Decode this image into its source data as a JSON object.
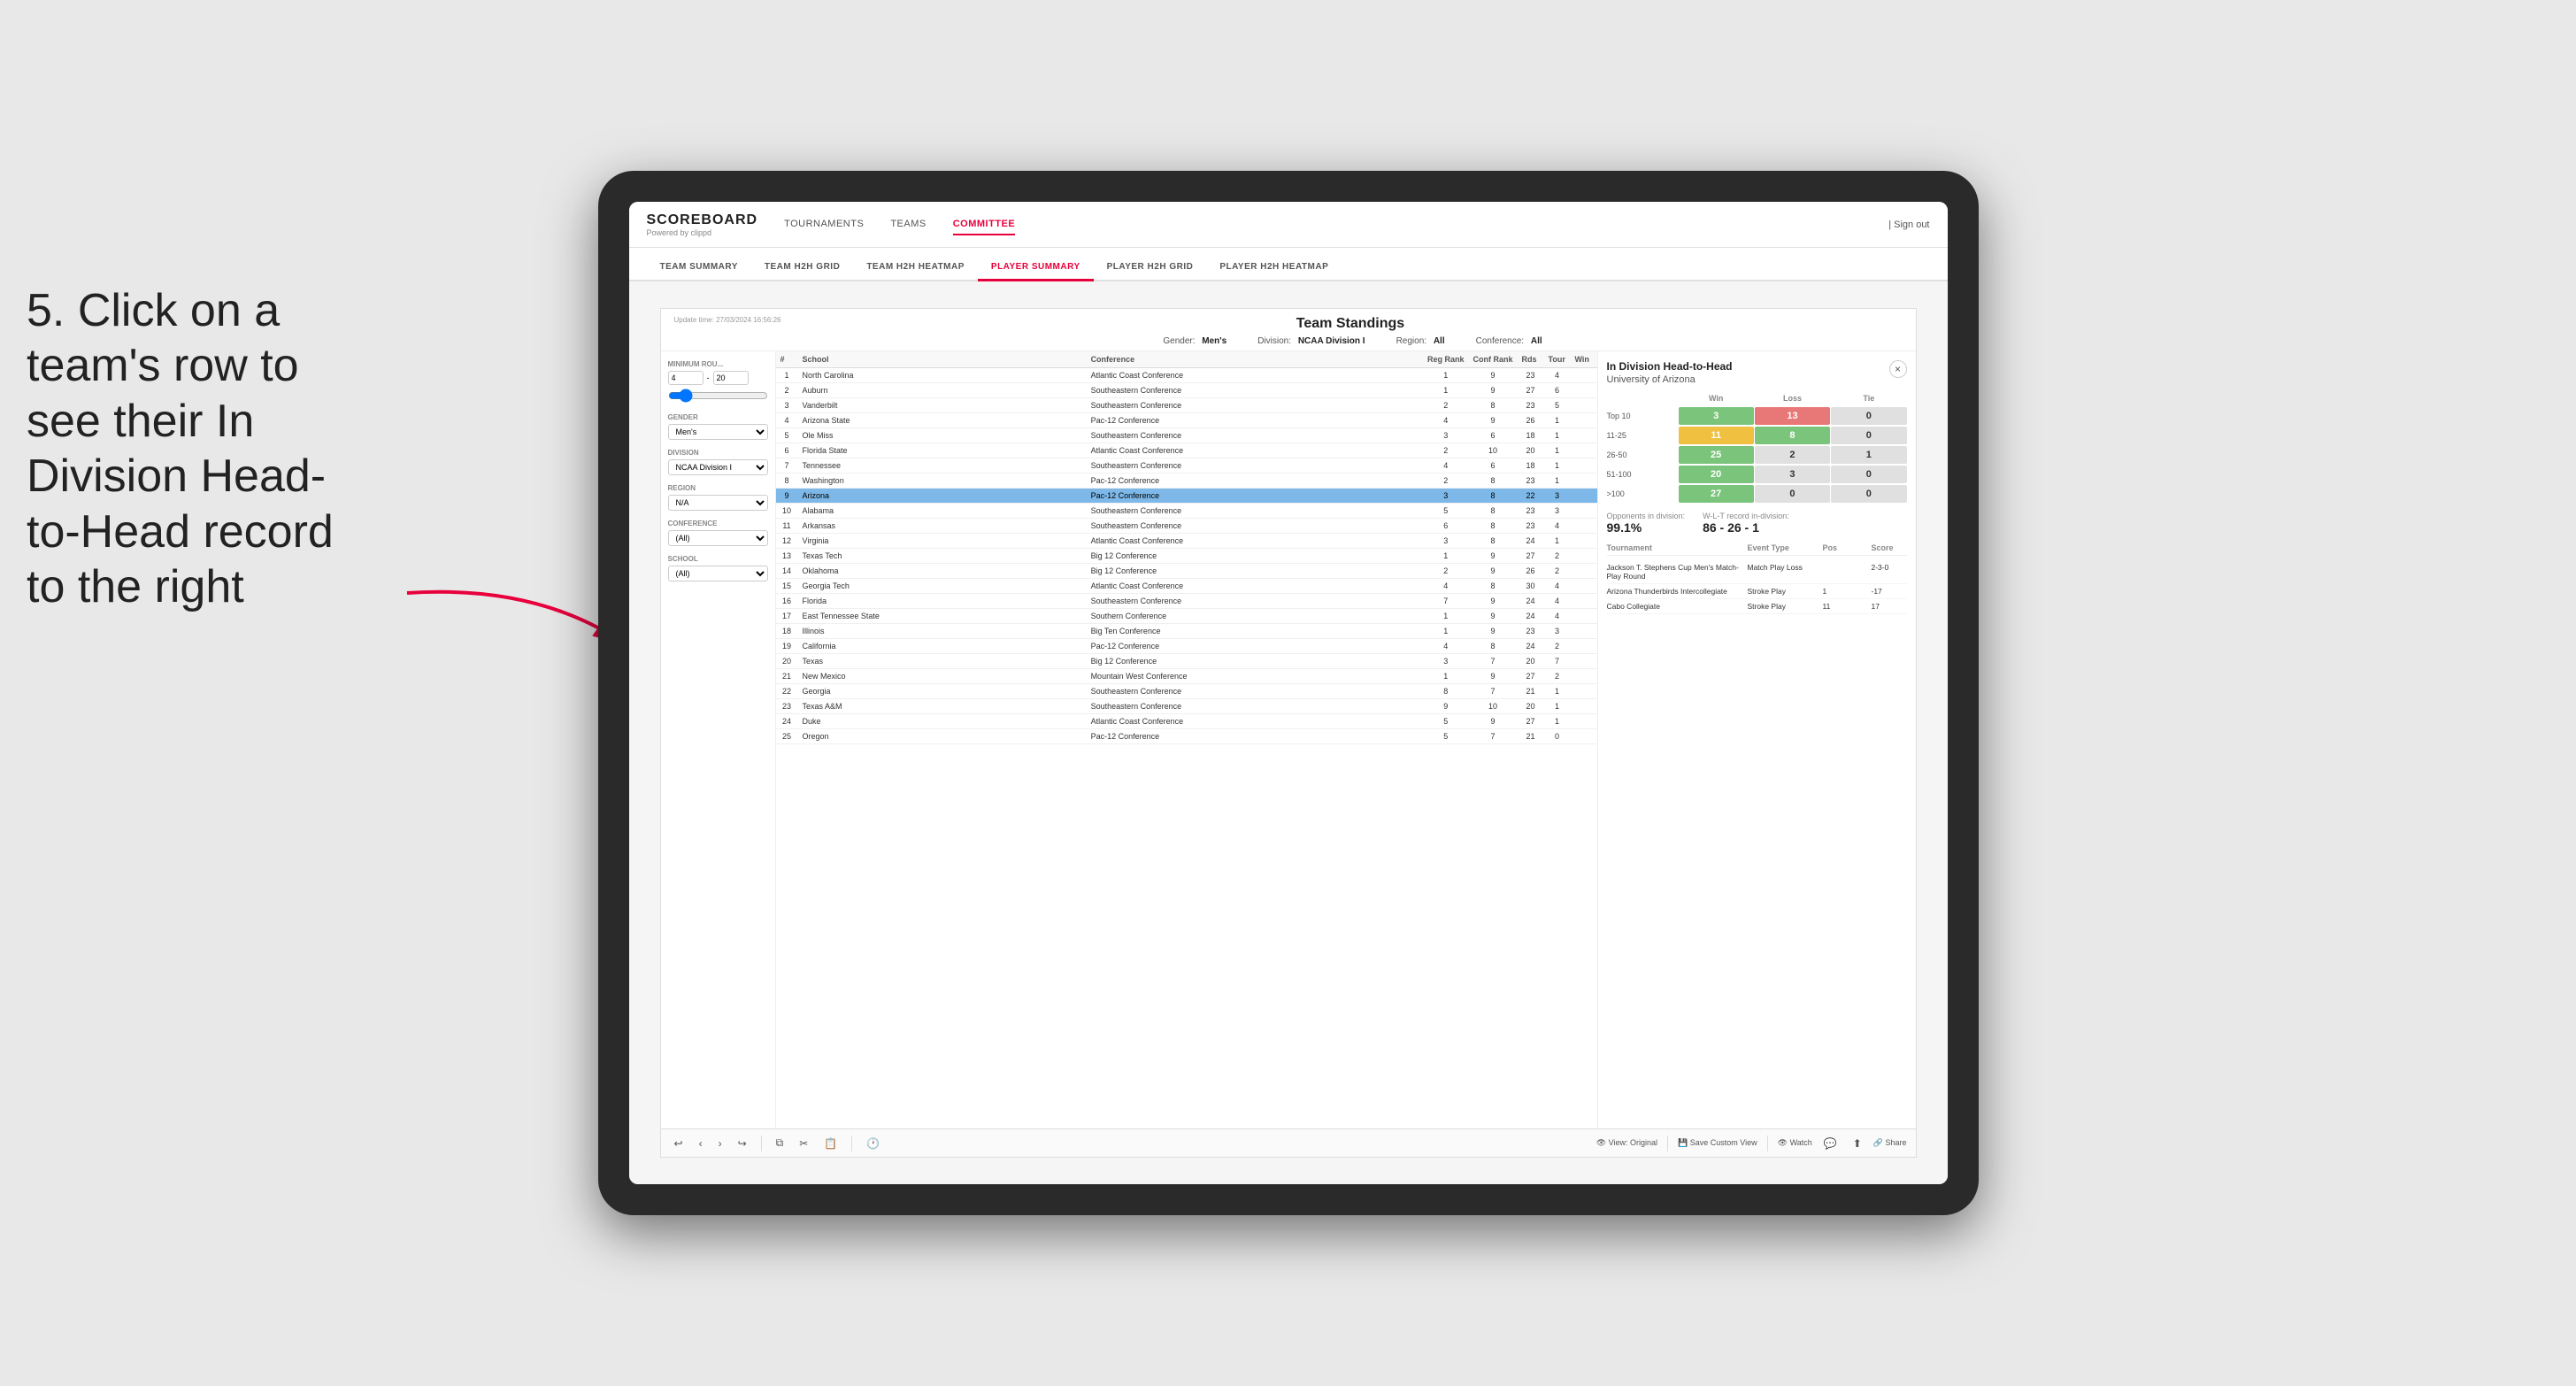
{
  "page": {
    "background": "#e8e8e8"
  },
  "instruction": {
    "text": "5. Click on a team's row to see their In Division Head-to-Head record to the right"
  },
  "nav": {
    "logo": "SCOREBOARD",
    "logo_sub": "Powered by clippd",
    "links": [
      "TOURNAMENTS",
      "TEAMS",
      "COMMITTEE"
    ],
    "active_link": "COMMITTEE",
    "sign_out": "Sign out"
  },
  "sub_nav": {
    "items": [
      "TEAM SUMMARY",
      "TEAM H2H GRID",
      "TEAM H2H HEATMAP",
      "PLAYER SUMMARY",
      "PLAYER H2H GRID",
      "PLAYER H2H HEATMAP"
    ],
    "active_item": "PLAYER SUMMARY"
  },
  "panel": {
    "update_time_label": "Update time:",
    "update_time": "27/03/2024 16:56:26",
    "title": "Team Standings",
    "gender_label": "Gender:",
    "gender": "Men's",
    "division_label": "Division:",
    "division": "NCAA Division I",
    "region_label": "Region:",
    "region": "All",
    "conference_label": "Conference:",
    "conference": "All"
  },
  "filters": {
    "min_rounds_label": "Minimum Rou...",
    "min_rounds_val": "4",
    "min_rounds_max": "20",
    "gender_label": "Gender",
    "gender_val": "Men's",
    "division_label": "Division",
    "division_val": "NCAA Division I",
    "region_label": "Region",
    "region_val": "N/A",
    "conference_label": "Conference",
    "conference_val": "(All)",
    "school_label": "School",
    "school_val": "(All)"
  },
  "table": {
    "headers": [
      "#",
      "School",
      "Conference",
      "Reg Rank",
      "Conf Rank",
      "Rds",
      "Tour",
      "Win"
    ],
    "rows": [
      {
        "rank": "1",
        "school": "North Carolina",
        "conference": "Atlantic Coast Conference",
        "reg_rank": "1",
        "conf_rank": "9",
        "rds": "23",
        "tour": "4",
        "win": "",
        "highlighted": false
      },
      {
        "rank": "2",
        "school": "Auburn",
        "conference": "Southeastern Conference",
        "reg_rank": "1",
        "conf_rank": "9",
        "rds": "27",
        "tour": "6",
        "win": "",
        "highlighted": false
      },
      {
        "rank": "3",
        "school": "Vanderbilt",
        "conference": "Southeastern Conference",
        "reg_rank": "2",
        "conf_rank": "8",
        "rds": "23",
        "tour": "5",
        "win": "",
        "highlighted": false
      },
      {
        "rank": "4",
        "school": "Arizona State",
        "conference": "Pac-12 Conference",
        "reg_rank": "4",
        "conf_rank": "9",
        "rds": "26",
        "tour": "1",
        "win": "",
        "highlighted": false
      },
      {
        "rank": "5",
        "school": "Ole Miss",
        "conference": "Southeastern Conference",
        "reg_rank": "3",
        "conf_rank": "6",
        "rds": "18",
        "tour": "1",
        "win": "",
        "highlighted": false
      },
      {
        "rank": "6",
        "school": "Florida State",
        "conference": "Atlantic Coast Conference",
        "reg_rank": "2",
        "conf_rank": "10",
        "rds": "20",
        "tour": "1",
        "win": "",
        "highlighted": false
      },
      {
        "rank": "7",
        "school": "Tennessee",
        "conference": "Southeastern Conference",
        "reg_rank": "4",
        "conf_rank": "6",
        "rds": "18",
        "tour": "1",
        "win": "",
        "highlighted": false
      },
      {
        "rank": "8",
        "school": "Washington",
        "conference": "Pac-12 Conference",
        "reg_rank": "2",
        "conf_rank": "8",
        "rds": "23",
        "tour": "1",
        "win": "",
        "highlighted": false
      },
      {
        "rank": "9",
        "school": "Arizona",
        "conference": "Pac-12 Conference",
        "reg_rank": "3",
        "conf_rank": "8",
        "rds": "22",
        "tour": "3",
        "win": "",
        "highlighted": true
      },
      {
        "rank": "10",
        "school": "Alabama",
        "conference": "Southeastern Conference",
        "reg_rank": "5",
        "conf_rank": "8",
        "rds": "23",
        "tour": "3",
        "win": "",
        "highlighted": false
      },
      {
        "rank": "11",
        "school": "Arkansas",
        "conference": "Southeastern Conference",
        "reg_rank": "6",
        "conf_rank": "8",
        "rds": "23",
        "tour": "4",
        "win": "",
        "highlighted": false
      },
      {
        "rank": "12",
        "school": "Virginia",
        "conference": "Atlantic Coast Conference",
        "reg_rank": "3",
        "conf_rank": "8",
        "rds": "24",
        "tour": "1",
        "win": "",
        "highlighted": false
      },
      {
        "rank": "13",
        "school": "Texas Tech",
        "conference": "Big 12 Conference",
        "reg_rank": "1",
        "conf_rank": "9",
        "rds": "27",
        "tour": "2",
        "win": "",
        "highlighted": false
      },
      {
        "rank": "14",
        "school": "Oklahoma",
        "conference": "Big 12 Conference",
        "reg_rank": "2",
        "conf_rank": "9",
        "rds": "26",
        "tour": "2",
        "win": "",
        "highlighted": false
      },
      {
        "rank": "15",
        "school": "Georgia Tech",
        "conference": "Atlantic Coast Conference",
        "reg_rank": "4",
        "conf_rank": "8",
        "rds": "30",
        "tour": "4",
        "win": "",
        "highlighted": false
      },
      {
        "rank": "16",
        "school": "Florida",
        "conference": "Southeastern Conference",
        "reg_rank": "7",
        "conf_rank": "9",
        "rds": "24",
        "tour": "4",
        "win": "",
        "highlighted": false
      },
      {
        "rank": "17",
        "school": "East Tennessee State",
        "conference": "Southern Conference",
        "reg_rank": "1",
        "conf_rank": "9",
        "rds": "24",
        "tour": "4",
        "win": "",
        "highlighted": false
      },
      {
        "rank": "18",
        "school": "Illinois",
        "conference": "Big Ten Conference",
        "reg_rank": "1",
        "conf_rank": "9",
        "rds": "23",
        "tour": "3",
        "win": "",
        "highlighted": false
      },
      {
        "rank": "19",
        "school": "California",
        "conference": "Pac-12 Conference",
        "reg_rank": "4",
        "conf_rank": "8",
        "rds": "24",
        "tour": "2",
        "win": "",
        "highlighted": false
      },
      {
        "rank": "20",
        "school": "Texas",
        "conference": "Big 12 Conference",
        "reg_rank": "3",
        "conf_rank": "7",
        "rds": "20",
        "tour": "7",
        "win": "",
        "highlighted": false
      },
      {
        "rank": "21",
        "school": "New Mexico",
        "conference": "Mountain West Conference",
        "reg_rank": "1",
        "conf_rank": "9",
        "rds": "27",
        "tour": "2",
        "win": "",
        "highlighted": false
      },
      {
        "rank": "22",
        "school": "Georgia",
        "conference": "Southeastern Conference",
        "reg_rank": "8",
        "conf_rank": "7",
        "rds": "21",
        "tour": "1",
        "win": "",
        "highlighted": false
      },
      {
        "rank": "23",
        "school": "Texas A&M",
        "conference": "Southeastern Conference",
        "reg_rank": "9",
        "conf_rank": "10",
        "rds": "20",
        "tour": "1",
        "win": "",
        "highlighted": false
      },
      {
        "rank": "24",
        "school": "Duke",
        "conference": "Atlantic Coast Conference",
        "reg_rank": "5",
        "conf_rank": "9",
        "rds": "27",
        "tour": "1",
        "win": "",
        "highlighted": false
      },
      {
        "rank": "25",
        "school": "Oregon",
        "conference": "Pac-12 Conference",
        "reg_rank": "5",
        "conf_rank": "7",
        "rds": "21",
        "tour": "0",
        "win": "",
        "highlighted": false
      }
    ]
  },
  "h2h": {
    "title": "In Division Head-to-Head",
    "school": "University of Arizona",
    "close_label": "×",
    "col_headers": [
      "",
      "Win",
      "Loss",
      "Tie"
    ],
    "rows": [
      {
        "range": "Top 10",
        "win": "3",
        "loss": "13",
        "tie": "0",
        "win_color": "green",
        "loss_color": "red",
        "tie_color": "gray"
      },
      {
        "range": "11-25",
        "win": "11",
        "loss": "8",
        "tie": "0",
        "win_color": "yellow",
        "loss_color": "green",
        "tie_color": "gray"
      },
      {
        "range": "26-50",
        "win": "25",
        "loss": "2",
        "tie": "1",
        "win_color": "green",
        "loss_color": "gray",
        "tie_color": "gray"
      },
      {
        "range": "51-100",
        "win": "20",
        "loss": "3",
        "tie": "0",
        "win_color": "green",
        "loss_color": "gray",
        "tie_color": "gray"
      },
      {
        "range": ">100",
        "win": "27",
        "loss": "0",
        "tie": "0",
        "win_color": "green",
        "loss_color": "gray",
        "tie_color": "gray"
      }
    ],
    "opponents_label": "Opponents in division:",
    "opponents_pct": "99.1%",
    "wlt_label": "W-L-T record in-division:",
    "wlt_record": "86 - 26 - 1",
    "tournaments_label": "Tournament",
    "event_type_label": "Event Type",
    "pos_label": "Pos",
    "score_label": "Score",
    "tournaments": [
      {
        "name": "Jackson T. Stephens Cup Men's Match-Play Round",
        "event_type": "Match Play",
        "result": "Loss",
        "score": "2-3-0",
        "extra": "1"
      },
      {
        "name": "Arizona Thunderbirds Intercollegiate",
        "event_type": "Stroke Play",
        "pos": "1",
        "score": "-17"
      },
      {
        "name": "Cabo Collegiate",
        "event_type": "Stroke Play",
        "pos": "11",
        "score": "17"
      }
    ]
  },
  "toolbar": {
    "undo": "↩",
    "redo": "↪",
    "view_original": "View: Original",
    "save_custom": "Save Custom View",
    "watch": "Watch",
    "share": "Share"
  }
}
